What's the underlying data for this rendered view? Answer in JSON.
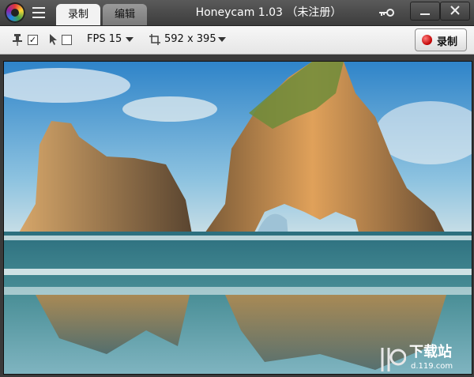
{
  "titlebar": {
    "title": "Honeycam 1.03 （未注册）",
    "tabs": [
      {
        "label": "录制",
        "active": true
      },
      {
        "label": "编辑",
        "active": false
      }
    ]
  },
  "toolbar": {
    "pin_checked": true,
    "cursor_checked": false,
    "fps_label": "FPS 15",
    "size_label": "592 x 395",
    "record_label": "录制"
  },
  "icons": [
    "logo-icon",
    "menu-icon",
    "key-icon",
    "minimize-icon",
    "close-icon",
    "pin-icon",
    "cursor-icon",
    "crop-icon",
    "record-dot-icon"
  ],
  "watermark": {
    "title": "下载站",
    "domain": "d.119.com"
  },
  "colors": {
    "record": "#d00000",
    "titlebar": "#3c3c3c",
    "toolbar": "#eeeeee"
  }
}
